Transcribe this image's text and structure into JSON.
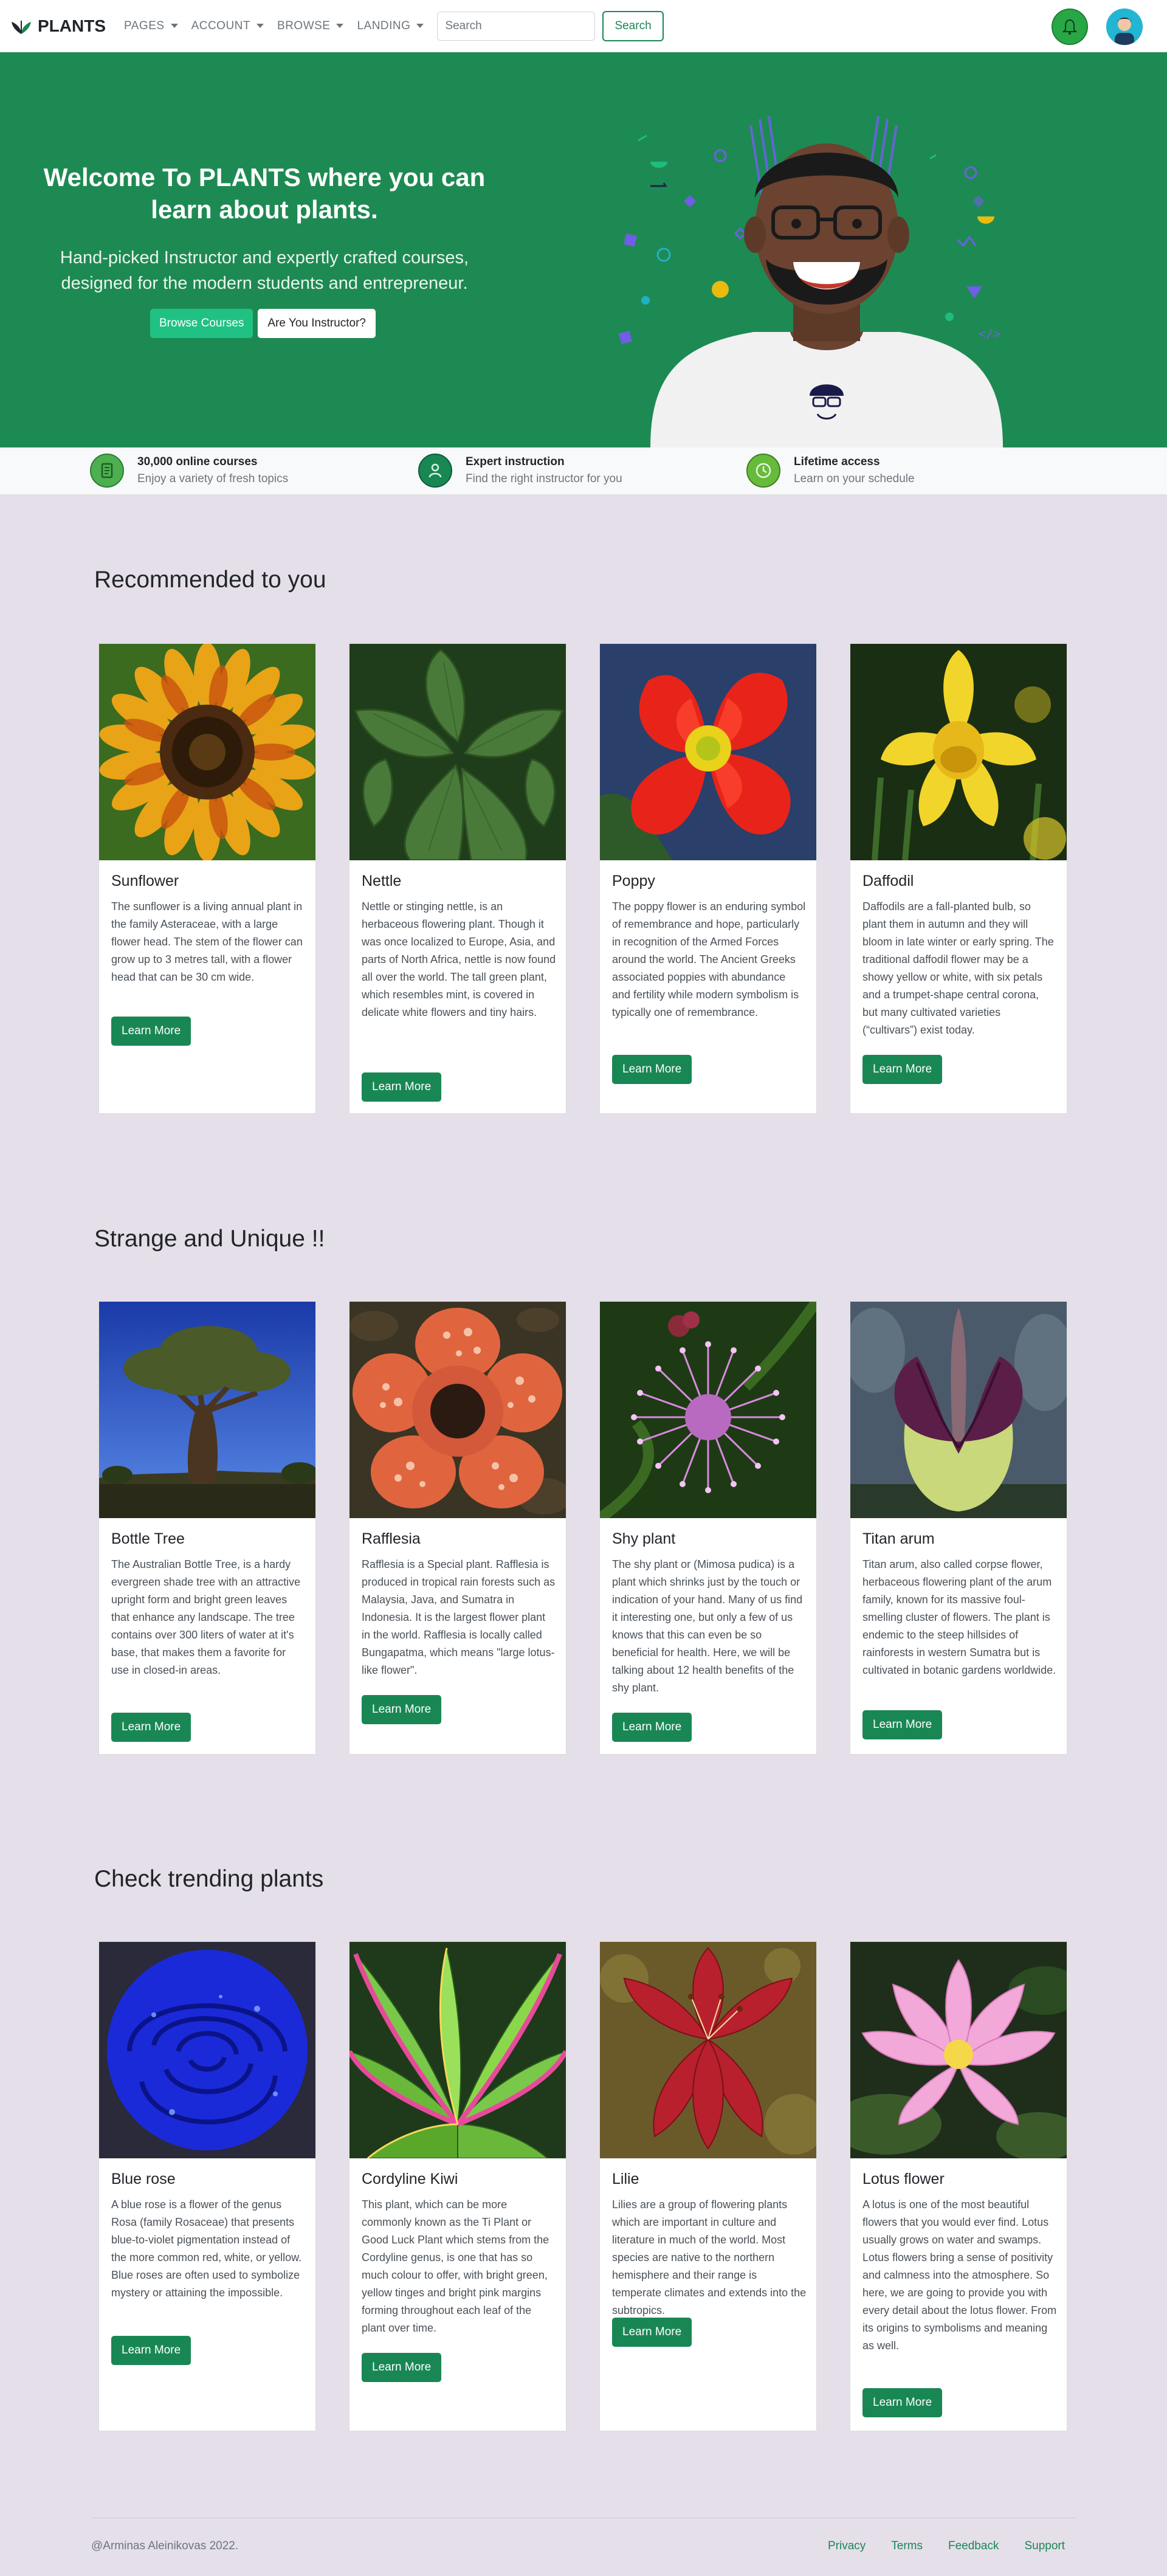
{
  "navbar": {
    "brand": "PLANTS",
    "menu": [
      "PAGES",
      "ACCOUNT",
      "BROWSE",
      "LANDING"
    ],
    "search_placeholder": "Search",
    "search_button": "Search"
  },
  "hero": {
    "title": "Welcome To PLANTS where you can learn about plants.",
    "subtitle": "Hand-picked Instructor and expertly crafted courses, designed for the modern students and entrepreneur.",
    "browse_button": "Browse Courses",
    "instructor_button": "Are You Instructor?",
    "background_color": "#1e8a53"
  },
  "features": [
    {
      "title": "30,000 online courses",
      "subtitle": "Enjoy a variety of fresh topics",
      "icon": "book-icon"
    },
    {
      "title": "Expert instruction",
      "subtitle": "Find the right instructor for you",
      "icon": "person-icon"
    },
    {
      "title": "Lifetime access",
      "subtitle": "Learn on your schedule",
      "icon": "clock-icon"
    }
  ],
  "sections": [
    {
      "title": "Recommended to you",
      "cards": [
        {
          "title": "Sunflower",
          "text": "The sunflower is a living annual plant in the family Asteraceae, with a large flower head. The stem of the flower can grow up to 3 metres tall, with a flower head that can be 30 cm wide.",
          "button": "Learn More"
        },
        {
          "title": "Nettle",
          "text": "Nettle or stinging nettle, is an herbaceous flowering plant. Though it was once localized to Europe, Asia, and parts of North Africa, nettle is now found all over the world. The tall green plant, which resembles mint, is covered in delicate white flowers and tiny hairs.",
          "button": "Learn More"
        },
        {
          "title": "Poppy",
          "text": "The poppy flower is an enduring symbol of remembrance and hope, particularly in recognition of the Armed Forces around the world. The Ancient Greeks associated poppies with abundance and fertility while modern symbolism is typically one of remembrance.",
          "button": "Learn More"
        },
        {
          "title": "Daffodil",
          "text": "Daffodils are a fall-planted bulb, so plant them in autumn and they will bloom in late winter or early spring. The traditional daffodil flower may be a showy yellow or white, with six petals and a trumpet-shape central corona, but many cultivated varieties (“cultivars”) exist today.",
          "button": "Learn More"
        }
      ]
    },
    {
      "title": "Strange and Unique !!",
      "cards": [
        {
          "title": "Bottle Tree",
          "text": "The Australian Bottle Tree, is a hardy evergreen shade tree with an attractive upright form and bright green leaves that enhance any landscape. The tree contains over 300 liters of water at it's base, that makes them a favorite for use in closed-in areas.",
          "button": "Learn More"
        },
        {
          "title": "Rafflesia",
          "text": "Rafflesia is a Special plant. Rafflesia is produced in tropical rain forests such as Malaysia, Java, and Sumatra in Indonesia. It is the largest flower plant in the world. Rafflesia is locally called Bungapatma, which means \"large lotus-like flower\".",
          "button": "Learn More"
        },
        {
          "title": "Shy plant",
          "text": "The shy plant or (Mimosa pudica) is a plant which shrinks just by the touch or indication of your hand. Many of us find it interesting one, but only a few of us knows that this can even be so beneficial for health. Here, we will be talking about 12 health benefits of the shy plant.",
          "button": "Learn More"
        },
        {
          "title": "Titan arum",
          "text": "Titan arum, also called corpse flower, herbaceous flowering plant of the arum family, known for its massive foul-smelling cluster of flowers. The plant is endemic to the steep hillsides of rainforests in western Sumatra but is cultivated in botanic gardens worldwide.",
          "button": "Learn More"
        }
      ]
    },
    {
      "title": "Check trending plants",
      "cards": [
        {
          "title": "Blue rose",
          "text": "A blue rose is a flower of the genus Rosa (family Rosaceae) that presents blue-to-violet pigmentation instead of the more common red, white, or yellow. Blue roses are often used to symbolize mystery or attaining the impossible.",
          "button": "Learn More"
        },
        {
          "title": "Cordyline Kiwi",
          "text": "This plant, which can be more commonly known as the Ti Plant or Good Luck Plant which stems from the Cordyline genus, is one that has so much colour to offer, with bright green, yellow tinges and bright pink margins forming throughout each leaf of the plant over time.",
          "button": "Learn More"
        },
        {
          "title": "Lilie",
          "text": "Lilies are a group of flowering plants which are important in culture and literature in much of the world. Most species are native to the northern hemisphere and their range is temperate climates and extends into the subtropics.",
          "button": "Learn More"
        },
        {
          "title": "Lotus flower",
          "text": "A lotus is one of the most beautiful flowers that you would ever find. Lotus usually grows on water and swamps. Lotus flowers bring a sense of positivity and calmness into the atmosphere. So here, we are going to provide you with every detail about the lotus flower. From its origins to symbolisms and meaning as well.",
          "button": "Learn More"
        }
      ]
    }
  ],
  "footer": {
    "copyright": "@Arminas Aleinikovas 2022.",
    "links": [
      "Privacy",
      "Terms",
      "Feedback",
      "Support"
    ]
  }
}
